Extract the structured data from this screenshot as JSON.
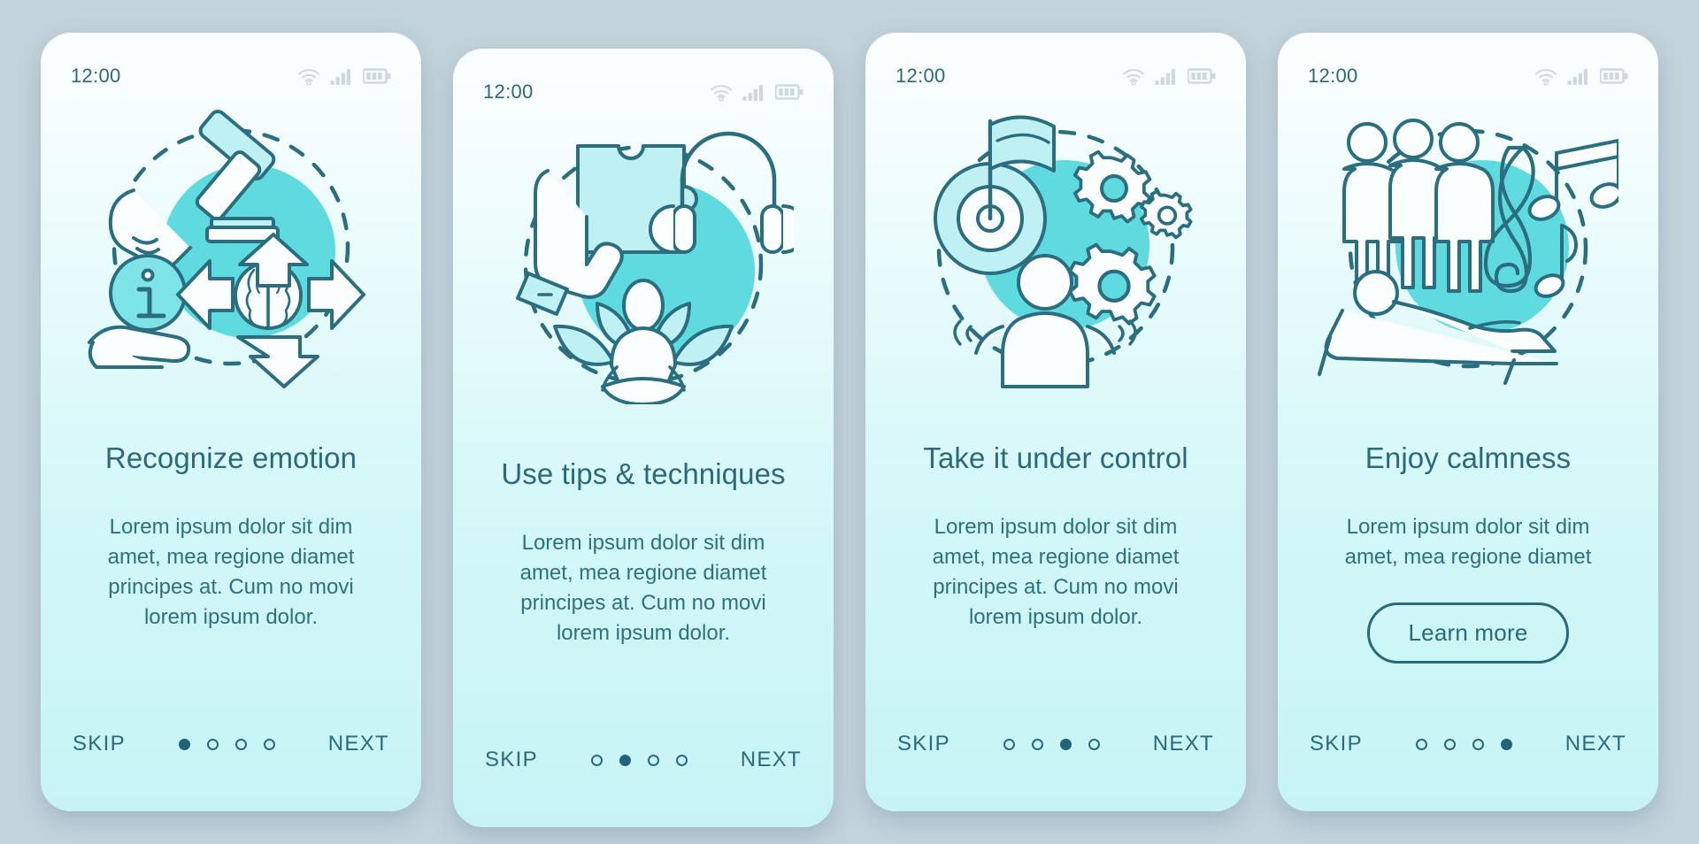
{
  "theme": {
    "page_background": "#c3d3dc",
    "screen_gradient_top": "#fbfeff",
    "screen_gradient_bottom": "#c6f4f6",
    "accent_dark": "#2b6a7c",
    "accent_line": "#2a6e80",
    "accent_fill": "#5fdbdf",
    "accent_fill_light": "#bff0f3",
    "status_icon_color": "#cdd9e0",
    "clock_color": "#2d6878"
  },
  "screens": [
    {
      "id": "screen-recognize-emotion",
      "status_bar": {
        "time": "12:00",
        "icons": [
          "wifi-icon",
          "signal-icon",
          "battery-icon"
        ]
      },
      "illustration": {
        "name": "recognize-emotion-illustration",
        "elements": [
          "gavel-icon",
          "hand-icon",
          "info-circle-icon",
          "brain-icon",
          "recycle-arrows-icon",
          "open-palm-icon",
          "dashed-circle"
        ]
      },
      "title": "Recognize emotion",
      "body": "Lorem ipsum dolor sit dim amet, mea regione diamet principes at. Cum no movi lorem ipsum dolor.",
      "cta": null,
      "footer": {
        "skip_label": "SKIP",
        "next_label": "NEXT",
        "dots_total": 4,
        "active_dot": 1
      }
    },
    {
      "id": "screen-use-tips",
      "status_bar": {
        "time": "12:00",
        "icons": [
          "wifi-icon",
          "signal-icon",
          "battery-icon"
        ]
      },
      "illustration": {
        "name": "use-tips-techniques-illustration",
        "elements": [
          "hand-icon",
          "puzzle-piece-icon",
          "headphones-icon",
          "lotus-meditation-icon",
          "dashed-circle"
        ]
      },
      "title": "Use tips & techniques",
      "body": "Lorem ipsum dolor sit dim amet, mea regione diamet principes at. Cum no movi lorem ipsum dolor.",
      "cta": null,
      "footer": {
        "skip_label": "SKIP",
        "next_label": "NEXT",
        "dots_total": 4,
        "active_dot": 2
      }
    },
    {
      "id": "screen-take-control",
      "status_bar": {
        "time": "12:00",
        "icons": [
          "wifi-icon",
          "signal-icon",
          "battery-icon"
        ]
      },
      "illustration": {
        "name": "take-it-under-control-illustration",
        "elements": [
          "target-flag-icon",
          "gears-icon",
          "person-icon",
          "dashed-circle"
        ]
      },
      "title": "Take it under control",
      "body": "Lorem ipsum dolor sit dim amet, mea regione diamet principes at. Cum no movi lorem ipsum dolor.",
      "cta": null,
      "footer": {
        "skip_label": "SKIP",
        "next_label": "NEXT",
        "dots_total": 4,
        "active_dot": 3
      }
    },
    {
      "id": "screen-enjoy-calmness",
      "status_bar": {
        "time": "12:00",
        "icons": [
          "wifi-icon",
          "signal-icon",
          "battery-icon"
        ]
      },
      "illustration": {
        "name": "enjoy-calmness-illustration",
        "elements": [
          "people-group-icon",
          "treble-clef-icon",
          "music-note-icon",
          "lounge-chair-person-icon",
          "dashed-circle"
        ]
      },
      "title": "Enjoy calmness",
      "body": "Lorem ipsum dolor sit dim amet, mea regione diamet",
      "cta": "Learn more",
      "footer": {
        "skip_label": "SKIP",
        "next_label": "NEXT",
        "dots_total": 4,
        "active_dot": 4
      }
    }
  ]
}
